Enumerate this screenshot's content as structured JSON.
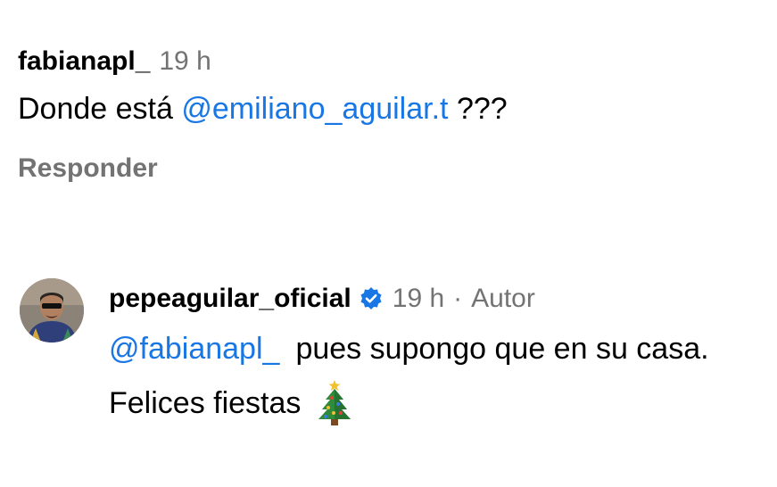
{
  "comment_1": {
    "username": "fabianapl_",
    "time": "19 h",
    "text_before": "Donde está ",
    "mention": "@emiliano_aguilar.t",
    "text_after": " ???",
    "reply_label": "Responder"
  },
  "comment_2": {
    "username": "pepeaguilar_oficial",
    "verified_icon": "verified-badge-icon",
    "time": "19 h",
    "separator": "·",
    "author_tag": "Autor",
    "mention": "@fabianapl_",
    "text_after_mention": "pues supongo que en su casa.",
    "line2_text": "Felices fiestas",
    "line2_icon": "christmas-tree-icon"
  },
  "colors": {
    "mention": "#1877e5",
    "secondary_text": "#737373",
    "verified_badge": "#1877e5"
  }
}
